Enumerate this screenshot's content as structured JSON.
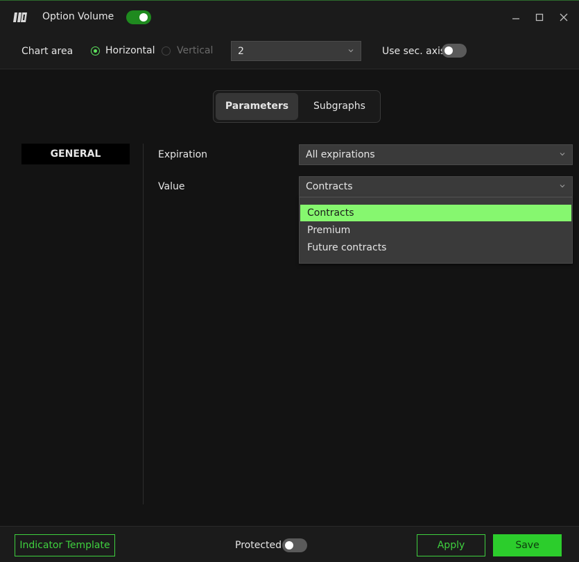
{
  "window": {
    "title": "Option Volume",
    "enabled": true,
    "controls": {
      "minimize_icon": "minimize-icon",
      "maximize_icon": "maximize-icon",
      "close_icon": "close-icon"
    }
  },
  "chart_area": {
    "label": "Chart area",
    "orientation_options": [
      {
        "label": "Horizontal",
        "selected": true
      },
      {
        "label": "Vertical",
        "selected": false
      }
    ],
    "pane_select": {
      "value": "2"
    },
    "sec_axis": {
      "label": "Use sec. axis",
      "enabled": false
    }
  },
  "tabs": [
    {
      "label": "Parameters",
      "active": true
    },
    {
      "label": "Subgraphs",
      "active": false
    }
  ],
  "nav": {
    "items": [
      {
        "label": "GENERAL",
        "active": true
      }
    ]
  },
  "params": {
    "expiration": {
      "label": "Expiration",
      "value": "All expirations"
    },
    "value": {
      "label": "Value",
      "value": "Contracts",
      "options": [
        "Contracts",
        "Premium",
        "Future contracts"
      ],
      "highlighted": "Contracts"
    }
  },
  "footer": {
    "template_label": "Indicator Template",
    "protected_label": "Protected",
    "protected_enabled": false,
    "apply_label": "Apply",
    "save_label": "Save"
  },
  "colors": {
    "accent": "#2ccd2c",
    "highlight": "#86f76f",
    "background": "#131313",
    "panel": "#1b1b1b"
  }
}
